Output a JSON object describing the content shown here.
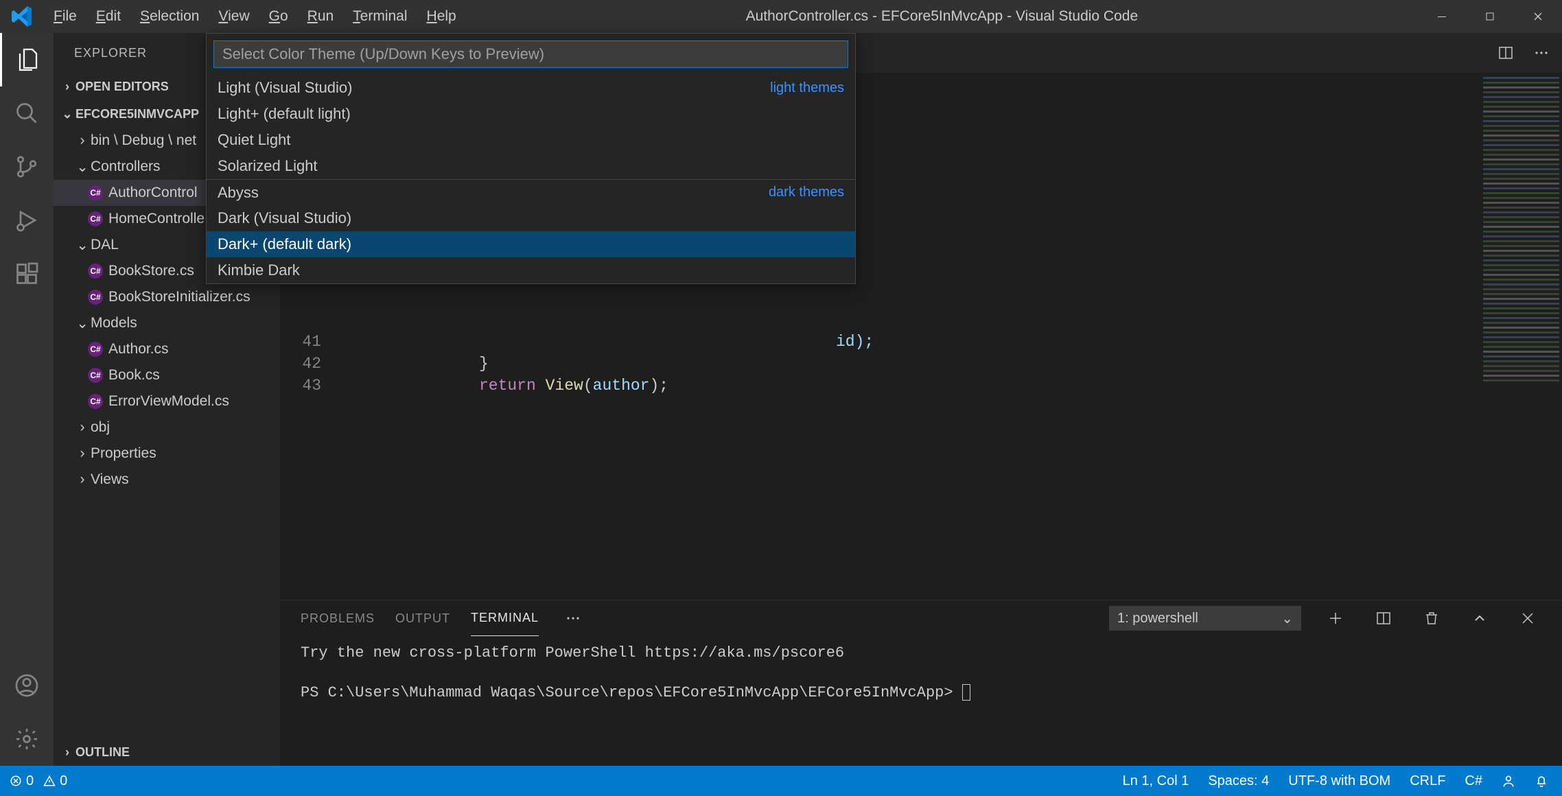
{
  "title": "AuthorController.cs - EFCore5InMvcApp - Visual Studio Code",
  "menu": {
    "file": "File",
    "edit": "Edit",
    "selection": "Selection",
    "view": "View",
    "go": "Go",
    "run": "Run",
    "terminal": "Terminal",
    "help": "Help"
  },
  "sidebar": {
    "title": "EXPLORER",
    "open_editors": "OPEN EDITORS",
    "project": "EFCORE5INMVCAPP",
    "outline": "OUTLINE",
    "tree": {
      "bin_debug": "bin \\ Debug \\ net",
      "controllers": "Controllers",
      "author_controller": "AuthorControl",
      "home_controller": "HomeControlle",
      "dal": "DAL",
      "bookstore": "BookStore.cs",
      "bookstore_init": "BookStoreInitializer.cs",
      "models": "Models",
      "author": "Author.cs",
      "book": "Book.cs",
      "errorvm": "ErrorViewModel.cs",
      "obj": "obj",
      "properties": "Properties",
      "views": "Views"
    }
  },
  "quick_input": {
    "placeholder": "Select Color Theme (Up/Down Keys to Preview)",
    "light_label": "light themes",
    "dark_label": "dark themes",
    "items": {
      "light_vs": "Light (Visual Studio)",
      "light_plus": "Light+ (default light)",
      "quiet_light": "Quiet Light",
      "solarized_light": "Solarized Light",
      "abyss": "Abyss",
      "dark_vs": "Dark (Visual Studio)",
      "dark_plus": "Dark+ (default dark)",
      "kimbie": "Kimbie Dark"
    }
  },
  "editor": {
    "lines": {
      "l41": "41",
      "l42": "42",
      "l43": "43"
    },
    "code": {
      "id_frag": "id);",
      "brace": "}",
      "return_kw": "return",
      "view_fn": "View",
      "author_var": "author",
      "tail": ");"
    }
  },
  "panel": {
    "problems": "PROBLEMS",
    "output": "OUTPUT",
    "terminal": "TERMINAL",
    "term_select": "1: powershell",
    "line1": "Try the new cross-platform PowerShell https://aka.ms/pscore6",
    "line2": "PS C:\\Users\\Muhammad Waqas\\Source\\repos\\EFCore5InMvcApp\\EFCore5InMvcApp> "
  },
  "status": {
    "errors": "0",
    "warnings": "0",
    "ln_col": "Ln 1, Col 1",
    "spaces": "Spaces: 4",
    "encoding": "UTF-8 with BOM",
    "eol": "CRLF",
    "lang": "C#"
  }
}
